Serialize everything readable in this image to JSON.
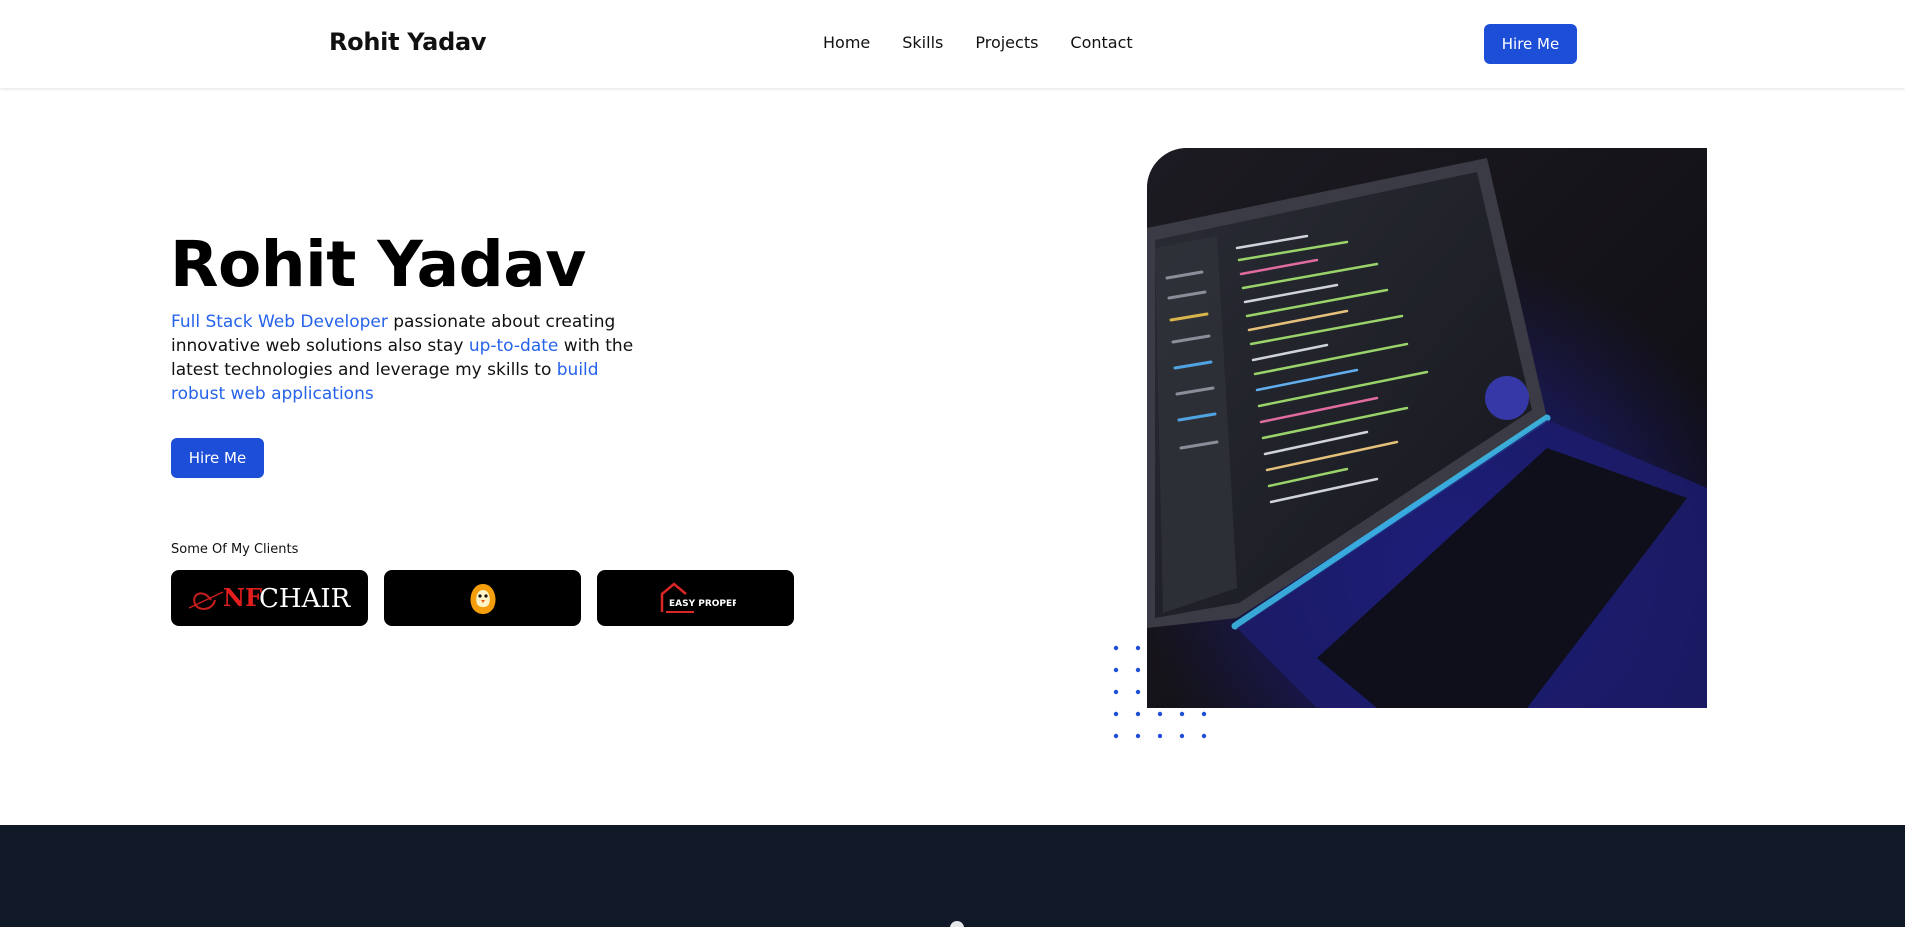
{
  "header": {
    "brand": "Rohit Yadav",
    "nav": [
      {
        "label": "Home"
      },
      {
        "label": "Skills"
      },
      {
        "label": "Projects"
      },
      {
        "label": "Contact"
      }
    ],
    "cta_label": "Hire Me"
  },
  "hero": {
    "title": "Rohit Yadav",
    "desc": {
      "hl1": "Full Stack Web Developer",
      "t1": " passionate about creating innovative web solutions also stay ",
      "hl2": "up-to-date",
      "t2": " with the latest technologies and leverage my skills to ",
      "hl3": "build robust web applications"
    },
    "cta_label": "Hire Me",
    "clients_label": "Some Of My Clients",
    "clients": [
      {
        "logo_text": "NF",
        "logo_text_2": "CHAIR"
      },
      {
        "logo_icon": "penguin-logo-icon"
      },
      {
        "logo_text": "EASY PROPERTI"
      }
    ]
  },
  "colors": {
    "accent": "#1d4ed8",
    "highlight_text": "#2563eb",
    "dark_band": "#111827"
  }
}
